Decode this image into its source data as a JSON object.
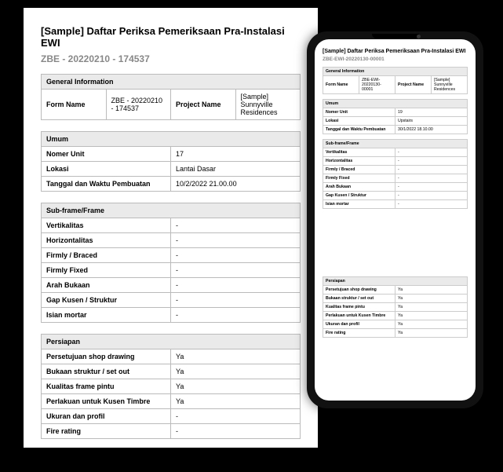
{
  "paper": {
    "title": "[Sample] Daftar Periksa Pemeriksaan Pra-Instalasi EWI",
    "subtitle": "ZBE - 20220210 - 174537",
    "general": {
      "header": "General Information",
      "form_name_label": "Form Name",
      "form_name_value": "ZBE - 20220210 - 174537",
      "project_name_label": "Project Name",
      "project_name_value": "[Sample] Sunnyville Residences"
    },
    "umum": {
      "header": "Umum",
      "rows": [
        {
          "label": "Nomer Unit",
          "value": "17"
        },
        {
          "label": "Lokasi",
          "value": "Lantai Dasar"
        },
        {
          "label": "Tanggal dan Waktu Pembuatan",
          "value": "10/2/2022 21.00.00"
        }
      ]
    },
    "subframe": {
      "header": "Sub-frame/Frame",
      "rows": [
        {
          "label": "Vertikalitas",
          "value": "-"
        },
        {
          "label": "Horizontalitas",
          "value": "-"
        },
        {
          "label": "Firmly / Braced",
          "value": "-"
        },
        {
          "label": "Firmly Fixed",
          "value": "-"
        },
        {
          "label": "Arah Bukaan",
          "value": "-"
        },
        {
          "label": "Gap Kusen / Struktur",
          "value": "-"
        },
        {
          "label": "Isian mortar",
          "value": "-"
        }
      ]
    },
    "persiapan": {
      "header": "Persiapan",
      "rows": [
        {
          "label": "Persetujuan shop drawing",
          "value": "Ya"
        },
        {
          "label": "Bukaan struktur / set out",
          "value": "Ya"
        },
        {
          "label": "Kualitas frame pintu",
          "value": "Ya"
        },
        {
          "label": "Perlakuan untuk Kusen Timbre",
          "value": "Ya"
        },
        {
          "label": "Ukuran dan profil",
          "value": "-"
        },
        {
          "label": "Fire rating",
          "value": "-"
        }
      ]
    }
  },
  "phone": {
    "title": "[Sample] Daftar Periksa Pemeriksaan Pra-Instalasi EWI",
    "subtitle": "ZBE-EWI-20220130-00001",
    "general": {
      "header": "General Information",
      "form_name_label": "Form Name",
      "form_name_value": "ZBE-EWI-20220130-00001",
      "project_name_label": "Project Name",
      "project_name_value": "[Sample] Sunnyville Residences"
    },
    "umum": {
      "header": "Umum",
      "rows": [
        {
          "label": "Nomer Unit",
          "value": "19"
        },
        {
          "label": "Lokasi",
          "value": "Upstairs"
        },
        {
          "label": "Tanggal dan Waktu Pembuatan",
          "value": "30/1/2022 18.10.00"
        }
      ]
    },
    "subframe": {
      "header": "Sub-frame/Frame",
      "rows": [
        {
          "label": "Vertikalitas",
          "value": "-"
        },
        {
          "label": "Horizontalitas",
          "value": "-"
        },
        {
          "label": "Firmly / Braced",
          "value": "-"
        },
        {
          "label": "Firmly Fixed",
          "value": "-"
        },
        {
          "label": "Arah Bukaan",
          "value": "-"
        },
        {
          "label": "Gap Kusen / Struktur",
          "value": "-"
        },
        {
          "label": "Isian mortar",
          "value": "-"
        }
      ]
    },
    "persiapan": {
      "header": "Persiapan",
      "rows": [
        {
          "label": "Persetujuan shop drawing",
          "value": "Ya"
        },
        {
          "label": "Bukaan struktur / set out",
          "value": "Ya"
        },
        {
          "label": "Kualitas frame pintu",
          "value": "Ya"
        },
        {
          "label": "Perlakuan untuk Kusen Timbre",
          "value": "Ya"
        },
        {
          "label": "Ukuran dan profil",
          "value": "Ya"
        },
        {
          "label": "Fire rating",
          "value": "Ya"
        }
      ]
    }
  }
}
